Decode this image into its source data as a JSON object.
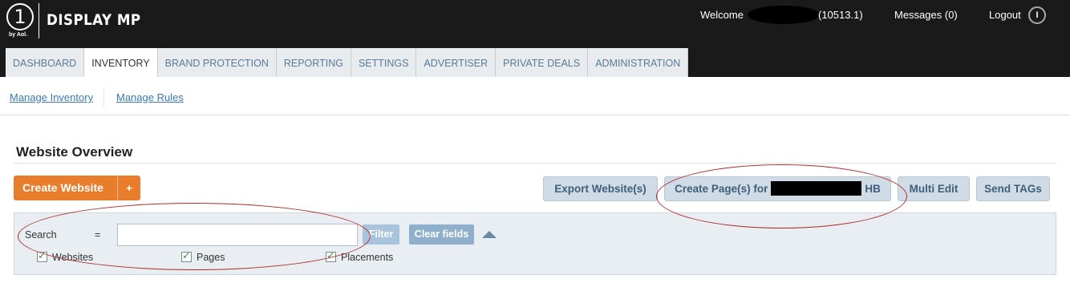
{
  "header": {
    "logo_numeral": "1",
    "logo_sub": "by Aol.",
    "app_name": "DISPLAY MP",
    "welcome_label": "Welcome",
    "account_id": "(10513.1)",
    "messages_label": "Messages (0)",
    "logout_label": "Logout",
    "logout_icon_glyph": "I"
  },
  "tabs": [
    {
      "label": "DASHBOARD"
    },
    {
      "label": "INVENTORY"
    },
    {
      "label": "BRAND PROTECTION"
    },
    {
      "label": "REPORTING"
    },
    {
      "label": "SETTINGS"
    },
    {
      "label": "ADVERTISER"
    },
    {
      "label": "PRIVATE DEALS"
    },
    {
      "label": "ADMINISTRATION"
    }
  ],
  "active_tab": "INVENTORY",
  "subnav": {
    "manage_inventory": "Manage Inventory",
    "manage_rules": "Manage Rules"
  },
  "page": {
    "title": "Website Overview"
  },
  "toolbar": {
    "create_website": "Create Website",
    "create_plus": "+",
    "export_websites": "Export Website(s)",
    "create_pages_prefix": "Create Page(s) for",
    "create_pages_suffix": "HB",
    "multi_edit": "Multi Edit",
    "send_tags": "Send TAGs"
  },
  "search": {
    "label": "Search",
    "operator": "=",
    "value": "",
    "placeholder": "",
    "filter_button": "Filter",
    "clear_button": "Clear fields",
    "checkboxes": [
      {
        "label": "Websites",
        "checked": true
      },
      {
        "label": "Pages",
        "checked": true
      },
      {
        "label": "Placements",
        "checked": true
      }
    ]
  },
  "colors": {
    "header_bg": "#1a1a1a",
    "accent_orange": "#e87d2c",
    "link_blue": "#3a7ab5",
    "annotation_red": "#b22a2a"
  }
}
